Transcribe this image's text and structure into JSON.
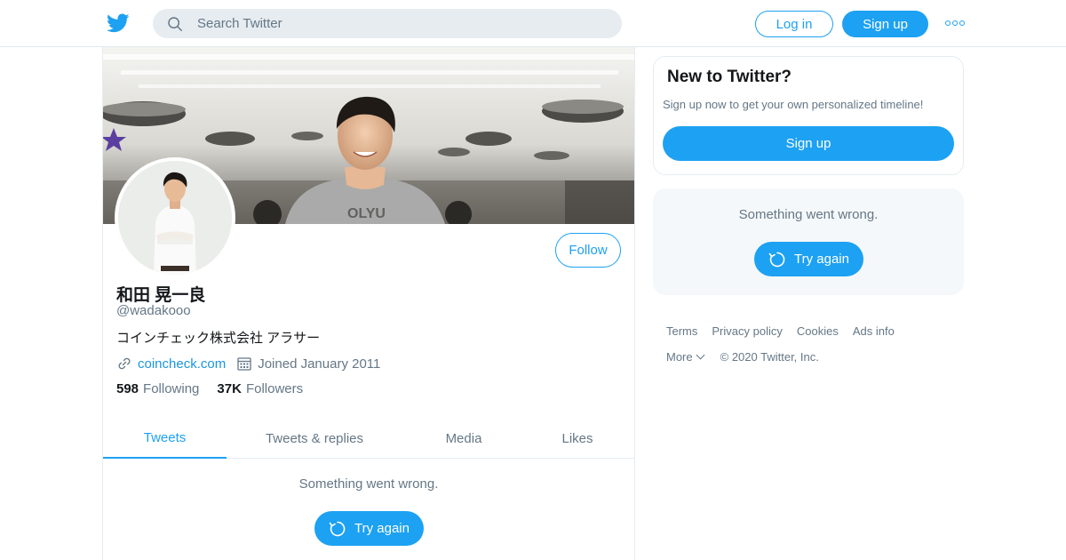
{
  "header": {
    "search_placeholder": "Search Twitter",
    "login_label": "Log in",
    "signup_label": "Sign up"
  },
  "profile": {
    "name": "和田 晃一良",
    "handle": "@wadakooo",
    "bio": "コインチェック株式会社 アラサー",
    "website": "coincheck.com",
    "joined": "Joined January 2011",
    "following_count": "598",
    "following_label": "Following",
    "followers_count": "37K",
    "followers_label": "Followers",
    "follow_label": "Follow"
  },
  "tabs": [
    {
      "label": "Tweets",
      "active": true
    },
    {
      "label": "Tweets & replies",
      "active": false
    },
    {
      "label": "Media",
      "active": false
    },
    {
      "label": "Likes",
      "active": false
    }
  ],
  "timeline": {
    "error_text": "Something went wrong.",
    "retry_label": "Try again"
  },
  "sidebar": {
    "new_title": "New to Twitter?",
    "new_text": "Sign up now to get your own personalized timeline!",
    "signup_label": "Sign up",
    "error_text": "Something went wrong.",
    "retry_label": "Try again"
  },
  "footer": {
    "links": [
      "Terms",
      "Privacy policy",
      "Cookies",
      "Ads info"
    ],
    "more_label": "More",
    "copyright": "© 2020 Twitter, Inc."
  },
  "colors": {
    "accent": "#1da1f2",
    "link": "#1b95e0",
    "secondary_text": "#657786"
  }
}
